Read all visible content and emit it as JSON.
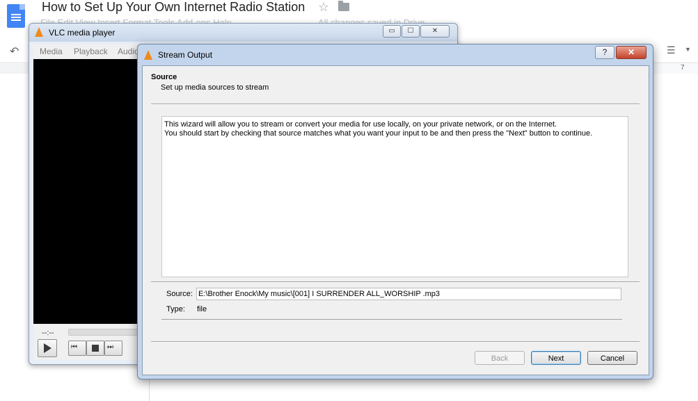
{
  "gdocs": {
    "title": "How to Set Up Your Own Internet Radio Station",
    "menu": "File   Edit   View   Insert   Format   Tools   Add-ons   Help",
    "saved": "All changes saved in Drive",
    "ruler_number": "7"
  },
  "vlc": {
    "title": "VLC media player",
    "menu": [
      "Media",
      "Playback",
      "Audio"
    ],
    "time": "--:--",
    "window_buttons": {
      "minimize": "▭",
      "maximize": "☐",
      "close": "✕"
    }
  },
  "dialog": {
    "title": "Stream Output",
    "help_label": "?",
    "close_label": "✕",
    "section_title": "Source",
    "section_subtitle": "Set up media sources to stream",
    "intro_line1": "This wizard will allow you to stream or convert your media for use locally, on your private network, or on the Internet.",
    "intro_line2": "You should start by checking that source matches what you want your input to be and then press the \"Next\" button to continue.",
    "source_label": "Source:",
    "source_value": "E:\\Brother Enock\\My music\\[001] I SURRENDER ALL_WORSHIP .mp3",
    "type_label": "Type:",
    "type_value": "file",
    "buttons": {
      "back": "Back",
      "next": "Next",
      "cancel": "Cancel"
    }
  },
  "icons": {
    "undo": "↶",
    "star": "☆",
    "list": "☰",
    "caret": "▼",
    "prev": "⏮",
    "next": "⏭"
  }
}
